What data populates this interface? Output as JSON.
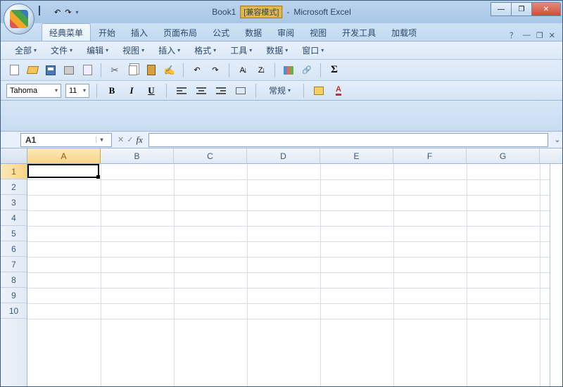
{
  "titlebar": {
    "doc": "Book1",
    "mode": "兼容模式",
    "app": "Microsoft Excel"
  },
  "ribbon": {
    "tabs": [
      "经典菜单",
      "开始",
      "插入",
      "页面布局",
      "公式",
      "数据",
      "审阅",
      "视图",
      "开发工具",
      "加载项"
    ]
  },
  "classic_menu": {
    "items": [
      "全部",
      "文件",
      "编辑",
      "视图",
      "插入",
      "格式",
      "工具",
      "数据",
      "窗口"
    ]
  },
  "format": {
    "font_name": "Tahoma",
    "font_size": "11",
    "bold": "B",
    "italic": "I",
    "underline": "U",
    "general": "常规"
  },
  "formula": {
    "name_box": "A1",
    "fx": "fx"
  },
  "grid": {
    "columns": [
      "A",
      "B",
      "C",
      "D",
      "E",
      "F",
      "G"
    ],
    "rows": [
      "1",
      "2",
      "3",
      "4",
      "5",
      "6",
      "7",
      "8",
      "9",
      "10"
    ],
    "selected_col": "A",
    "selected_row": "1"
  },
  "icons": {
    "sigma": "Σ",
    "cut": "✂",
    "sort": "A↓",
    "undo": "↶",
    "redo": "↷",
    "min": "—",
    "max": "❐",
    "close": "✕",
    "help": "？",
    "dd": "▾",
    "expand": "⌄"
  }
}
